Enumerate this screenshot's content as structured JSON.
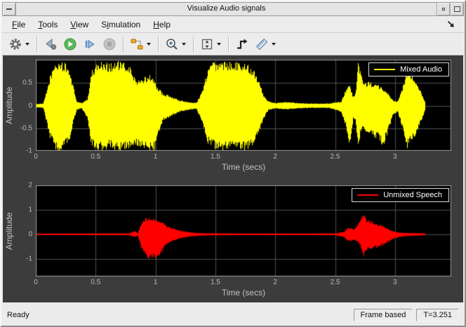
{
  "window": {
    "title": "Visualize Audio signals",
    "controls_left": [
      {
        "name": "window-menu-button",
        "glyph": "dash"
      }
    ],
    "controls_right": [
      {
        "name": "restore-button",
        "glyph": "dot"
      },
      {
        "name": "maximize-button",
        "glyph": "square"
      }
    ]
  },
  "menubar": {
    "items": [
      {
        "name": "menu-file",
        "pre": "",
        "u": "F",
        "post": "ile"
      },
      {
        "name": "menu-tools",
        "pre": "",
        "u": "T",
        "post": "ools"
      },
      {
        "name": "menu-view",
        "pre": "",
        "u": "V",
        "post": "iew"
      },
      {
        "name": "menu-simulation",
        "pre": "S",
        "u": "i",
        "post": "mulation"
      },
      {
        "name": "menu-help",
        "pre": "",
        "u": "H",
        "post": "elp"
      }
    ],
    "right_icon": "dock-arrow-icon"
  },
  "toolbar": {
    "items": [
      {
        "type": "button",
        "name": "settings-button",
        "icon": "gear-icon",
        "dropdown": true
      },
      {
        "type": "separator"
      },
      {
        "type": "button",
        "name": "step-back-button",
        "icon": "step-back-icon",
        "dropdown": false
      },
      {
        "type": "button",
        "name": "run-button",
        "icon": "play-icon",
        "dropdown": false
      },
      {
        "type": "button",
        "name": "step-forward-button",
        "icon": "step-forward-icon",
        "dropdown": false
      },
      {
        "type": "button",
        "name": "stop-button",
        "icon": "stop-icon",
        "dropdown": false
      },
      {
        "type": "separator"
      },
      {
        "type": "button",
        "name": "highlight-simulink-block-button",
        "icon": "signal-blocks-icon",
        "dropdown": true
      },
      {
        "type": "separator"
      },
      {
        "type": "button",
        "name": "zoom-in-button",
        "icon": "magnifier-plus-icon",
        "dropdown": true
      },
      {
        "type": "separator"
      },
      {
        "type": "button",
        "name": "scale-y-axis-button",
        "icon": "autoscale-icon",
        "dropdown": true
      },
      {
        "type": "separator"
      },
      {
        "type": "button",
        "name": "trigger-button",
        "icon": "trigger-icon",
        "dropdown": false
      },
      {
        "type": "button",
        "name": "cursor-measurements-button",
        "icon": "ruler-icon",
        "dropdown": true
      }
    ]
  },
  "statusbar": {
    "ready": "Ready",
    "frame_mode": "Frame based",
    "sim_time": "T=3.251"
  },
  "colors": {
    "figure_bg": "#3c3c3c",
    "axes_bg": "#000000",
    "grid": "#4f4f4f",
    "axes_border": "#9e9e9e",
    "tick_text": "#b8b8b8",
    "mixed_audio": "#ffff00",
    "unmixed_speech": "#ff0000"
  },
  "chart_data": [
    {
      "type": "line",
      "title": "",
      "xlabel": "Time (secs)",
      "ylabel": "Amplitude",
      "xlim": [
        0,
        3.47
      ],
      "ylim": [
        -1,
        1.02
      ],
      "xticks": [
        0,
        0.5,
        1,
        1.5,
        2,
        2.5,
        3
      ],
      "yticks": [
        -1,
        -0.5,
        0,
        0.5
      ],
      "grid": true,
      "legend": {
        "label": "Mixed Audio",
        "position": "top-right"
      },
      "color": "#ffff00",
      "t_end": 3.251,
      "series": [
        {
          "name": "Mixed Audio",
          "envelope_pos": [
            [
              0,
              0.04
            ],
            [
              0.06,
              0.05
            ],
            [
              0.09,
              0.35
            ],
            [
              0.12,
              0.7
            ],
            [
              0.16,
              0.95
            ],
            [
              0.2,
              1.0
            ],
            [
              0.24,
              0.95
            ],
            [
              0.28,
              0.8
            ],
            [
              0.31,
              0.45
            ],
            [
              0.34,
              0.1
            ],
            [
              0.38,
              0.06
            ],
            [
              0.43,
              0.15
            ],
            [
              0.46,
              0.75
            ],
            [
              0.5,
              0.95
            ],
            [
              0.56,
              1.0
            ],
            [
              0.62,
              0.95
            ],
            [
              0.68,
              1.0
            ],
            [
              0.74,
              0.95
            ],
            [
              0.79,
              0.85
            ],
            [
              0.83,
              0.6
            ],
            [
              0.87,
              0.55
            ],
            [
              0.91,
              0.65
            ],
            [
              0.95,
              0.7
            ],
            [
              0.99,
              0.55
            ],
            [
              1.02,
              0.4
            ],
            [
              1.06,
              0.28
            ],
            [
              1.12,
              0.22
            ],
            [
              1.2,
              0.12
            ],
            [
              1.28,
              0.08
            ],
            [
              1.34,
              0.07
            ],
            [
              1.39,
              0.35
            ],
            [
              1.43,
              0.8
            ],
            [
              1.47,
              1.0
            ],
            [
              1.53,
              0.95
            ],
            [
              1.6,
              1.0
            ],
            [
              1.68,
              1.0
            ],
            [
              1.75,
              0.95
            ],
            [
              1.81,
              0.85
            ],
            [
              1.86,
              0.6
            ],
            [
              1.9,
              0.25
            ],
            [
              1.94,
              0.1
            ],
            [
              2.0,
              0.06
            ],
            [
              2.07,
              0.09
            ],
            [
              2.13,
              0.08
            ],
            [
              2.2,
              0.06
            ],
            [
              2.3,
              0.05
            ],
            [
              2.45,
              0.05
            ],
            [
              2.55,
              0.1
            ],
            [
              2.59,
              0.4
            ],
            [
              2.62,
              0.45
            ],
            [
              2.65,
              0.2
            ],
            [
              2.67,
              0.3
            ],
            [
              2.69,
              0.95
            ],
            [
              2.71,
              0.8
            ],
            [
              2.74,
              0.5
            ],
            [
              2.78,
              0.55
            ],
            [
              2.82,
              0.5
            ],
            [
              2.86,
              0.45
            ],
            [
              2.9,
              0.4
            ],
            [
              2.94,
              0.3
            ],
            [
              2.98,
              0.12
            ],
            [
              3.02,
              0.1
            ],
            [
              3.06,
              0.4
            ],
            [
              3.1,
              0.8
            ],
            [
              3.14,
              0.7
            ],
            [
              3.18,
              0.55
            ],
            [
              3.22,
              0.3
            ],
            [
              3.251,
              0.08
            ]
          ],
          "envelope_neg": [
            [
              0,
              -0.04
            ],
            [
              0.06,
              -0.05
            ],
            [
              0.09,
              -0.4
            ],
            [
              0.12,
              -0.75
            ],
            [
              0.16,
              -1.0
            ],
            [
              0.2,
              -1.0
            ],
            [
              0.24,
              -0.9
            ],
            [
              0.28,
              -0.75
            ],
            [
              0.31,
              -0.4
            ],
            [
              0.34,
              -0.1
            ],
            [
              0.38,
              -0.06
            ],
            [
              0.43,
              -0.3
            ],
            [
              0.46,
              -0.9
            ],
            [
              0.5,
              -1.0
            ],
            [
              0.56,
              -1.0
            ],
            [
              0.62,
              -0.95
            ],
            [
              0.68,
              -1.0
            ],
            [
              0.74,
              -1.0
            ],
            [
              0.79,
              -0.95
            ],
            [
              0.83,
              -0.9
            ],
            [
              0.87,
              -1.0
            ],
            [
              0.91,
              -1.0
            ],
            [
              0.95,
              -1.0
            ],
            [
              0.99,
              -1.0
            ],
            [
              1.02,
              -0.7
            ],
            [
              1.06,
              -0.35
            ],
            [
              1.12,
              -0.25
            ],
            [
              1.2,
              -0.14
            ],
            [
              1.28,
              -0.09
            ],
            [
              1.34,
              -0.08
            ],
            [
              1.39,
              -0.4
            ],
            [
              1.43,
              -0.85
            ],
            [
              1.47,
              -0.95
            ],
            [
              1.53,
              -1.0
            ],
            [
              1.6,
              -1.0
            ],
            [
              1.68,
              -1.0
            ],
            [
              1.75,
              -1.0
            ],
            [
              1.81,
              -0.9
            ],
            [
              1.86,
              -0.65
            ],
            [
              1.9,
              -0.3
            ],
            [
              1.94,
              -0.1
            ],
            [
              2.0,
              -0.06
            ],
            [
              2.07,
              -0.09
            ],
            [
              2.13,
              -0.08
            ],
            [
              2.2,
              -0.06
            ],
            [
              2.3,
              -0.05
            ],
            [
              2.45,
              -0.05
            ],
            [
              2.55,
              -0.15
            ],
            [
              2.59,
              -0.5
            ],
            [
              2.62,
              -0.9
            ],
            [
              2.65,
              -0.3
            ],
            [
              2.67,
              -0.4
            ],
            [
              2.69,
              -1.0
            ],
            [
              2.71,
              -0.6
            ],
            [
              2.74,
              -0.55
            ],
            [
              2.78,
              -0.65
            ],
            [
              2.82,
              -0.7
            ],
            [
              2.86,
              -0.75
            ],
            [
              2.9,
              -0.9
            ],
            [
              2.94,
              -0.6
            ],
            [
              2.98,
              -0.2
            ],
            [
              3.02,
              -0.15
            ],
            [
              3.06,
              -0.5
            ],
            [
              3.1,
              -0.95
            ],
            [
              3.14,
              -0.8
            ],
            [
              3.18,
              -0.6
            ],
            [
              3.22,
              -0.35
            ],
            [
              3.251,
              -0.08
            ]
          ]
        }
      ]
    },
    {
      "type": "line",
      "title": "",
      "xlabel": "Time (secs)",
      "ylabel": "Amplitude",
      "xlim": [
        0,
        3.47
      ],
      "ylim": [
        -1.72,
        2
      ],
      "xticks": [
        0,
        0.5,
        1,
        1.5,
        2,
        2.5,
        3
      ],
      "yticks": [
        -1,
        0,
        1,
        2
      ],
      "grid": true,
      "legend": {
        "label": "Unmixed Speech",
        "position": "top-right"
      },
      "color": "#ff0000",
      "t_end": 3.251,
      "series": [
        {
          "name": "Unmixed Speech",
          "envelope_pos": [
            [
              0,
              0.03
            ],
            [
              0.4,
              0.035
            ],
            [
              0.78,
              0.04
            ],
            [
              0.82,
              0.14
            ],
            [
              0.85,
              0.06
            ],
            [
              0.88,
              0.5
            ],
            [
              0.92,
              0.68
            ],
            [
              0.96,
              0.7
            ],
            [
              1.0,
              0.65
            ],
            [
              1.04,
              0.55
            ],
            [
              1.08,
              0.4
            ],
            [
              1.13,
              0.28
            ],
            [
              1.2,
              0.16
            ],
            [
              1.28,
              0.09
            ],
            [
              1.36,
              0.05
            ],
            [
              1.5,
              0.04
            ],
            [
              1.8,
              0.035
            ],
            [
              2.2,
              0.035
            ],
            [
              2.5,
              0.04
            ],
            [
              2.57,
              0.1
            ],
            [
              2.61,
              0.28
            ],
            [
              2.65,
              0.22
            ],
            [
              2.68,
              0.35
            ],
            [
              2.71,
              0.6
            ],
            [
              2.73,
              0.92
            ],
            [
              2.76,
              0.6
            ],
            [
              2.8,
              0.55
            ],
            [
              2.85,
              0.45
            ],
            [
              2.9,
              0.35
            ],
            [
              2.95,
              0.2
            ],
            [
              3.0,
              0.1
            ],
            [
              3.08,
              0.06
            ],
            [
              3.18,
              0.05
            ],
            [
              3.251,
              0.04
            ]
          ],
          "envelope_neg": [
            [
              0,
              -0.03
            ],
            [
              0.4,
              -0.035
            ],
            [
              0.78,
              -0.04
            ],
            [
              0.82,
              -0.12
            ],
            [
              0.85,
              -0.06
            ],
            [
              0.88,
              -0.6
            ],
            [
              0.92,
              -1.0
            ],
            [
              0.96,
              -1.0
            ],
            [
              1.0,
              -1.0
            ],
            [
              1.04,
              -0.8
            ],
            [
              1.08,
              -0.5
            ],
            [
              1.13,
              -0.32
            ],
            [
              1.2,
              -0.18
            ],
            [
              1.28,
              -0.1
            ],
            [
              1.36,
              -0.06
            ],
            [
              1.5,
              -0.04
            ],
            [
              1.8,
              -0.035
            ],
            [
              2.2,
              -0.035
            ],
            [
              2.5,
              -0.04
            ],
            [
              2.57,
              -0.12
            ],
            [
              2.61,
              -0.3
            ],
            [
              2.65,
              -0.25
            ],
            [
              2.68,
              -0.3
            ],
            [
              2.71,
              -0.5
            ],
            [
              2.73,
              -1.0
            ],
            [
              2.76,
              -0.65
            ],
            [
              2.8,
              -0.6
            ],
            [
              2.85,
              -0.55
            ],
            [
              2.9,
              -0.45
            ],
            [
              2.95,
              -0.3
            ],
            [
              3.0,
              -0.15
            ],
            [
              3.08,
              -0.08
            ],
            [
              3.18,
              -0.06
            ],
            [
              3.251,
              -0.04
            ]
          ]
        }
      ]
    }
  ]
}
